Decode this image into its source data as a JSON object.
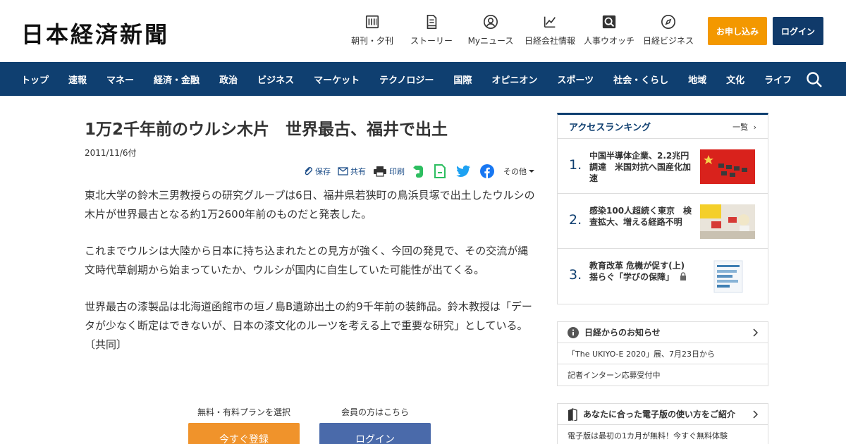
{
  "header": {
    "logo": "日本経済新聞",
    "util_nav": [
      {
        "label": "朝刊・夕刊",
        "icon": "newspaper-icon"
      },
      {
        "label": "ストーリー",
        "icon": "story-icon"
      },
      {
        "label": "Myニュース",
        "icon": "user-icon"
      },
      {
        "label": "日経会社情報",
        "icon": "chart-icon"
      },
      {
        "label": "人事ウオッチ",
        "icon": "search-person-icon"
      },
      {
        "label": "日経ビジネス",
        "icon": "compass-icon"
      }
    ],
    "apply_label": "お申し込み",
    "login_label": "ログイン",
    "apply_color": "#f39800",
    "login_color": "#103a6a"
  },
  "nav": {
    "items": [
      "トップ",
      "速報",
      "マネー",
      "経済・金融",
      "政治",
      "ビジネス",
      "マーケット",
      "テクノロジー",
      "国際",
      "オピニオン",
      "スポーツ",
      "社会・くらし",
      "地域",
      "文化",
      "ライフ"
    ],
    "bg_color": "#0f3f70"
  },
  "article": {
    "title": "1万2千年前のウルシ木片　世界最古、福井で出土",
    "date": "2011/11/6付",
    "share": {
      "save": "保存",
      "share": "共有",
      "print": "印刷",
      "other": "その他"
    },
    "paragraphs": [
      "東北大学の鈴木三男教授らの研究グループは6日、福井県若狭町の鳥浜貝塚で出土したウルシの木片が世界最古となる約1万2600年前のものだと発表した。",
      "これまでウルシは大陸から日本に持ち込まれたとの見方が強く、今回の発見で、その交流が縄文時代草創期から始まっていたか、ウルシが国内に自生していた可能性が出てくる。",
      "世界最古の漆製品は北海道函館市の垣ノ島B遺跡出土の約9千年前の装飾品。鈴木教授は「データが少なく断定はできないが、日本の漆文化のルーツを考える上で重要な研究」としている。〔共同〕"
    ]
  },
  "cta": {
    "register_caption": "無料・有料プランを選択",
    "register_label": "今すぐ登録",
    "login_caption": "会員の方はこちら",
    "login_label": "ログイン"
  },
  "ranking": {
    "title": "アクセスランキング",
    "more": "一覧",
    "items": [
      {
        "rank": "1.",
        "text": "中国半導体企業、2.2兆円調達　米国対抗へ国産化加速",
        "locked": false
      },
      {
        "rank": "2.",
        "text": "感染100人超続く東京　検査拡大、増える経路不明",
        "locked": false
      },
      {
        "rank": "3.",
        "text": "教育改革 危機が促す(上) 揺らぐ「学びの保障」",
        "locked": true
      }
    ]
  },
  "notice": {
    "title": "日経からのお知らせ",
    "items": [
      "「The UKIYO-E 2020」展、7月23日から",
      "記者インターン応募受付中"
    ]
  },
  "guide": {
    "title": "あなたに合った電子版の使い方をご紹介",
    "items": [
      "電子版は最初の1カ月が無料！今すぐ無料体験"
    ]
  }
}
